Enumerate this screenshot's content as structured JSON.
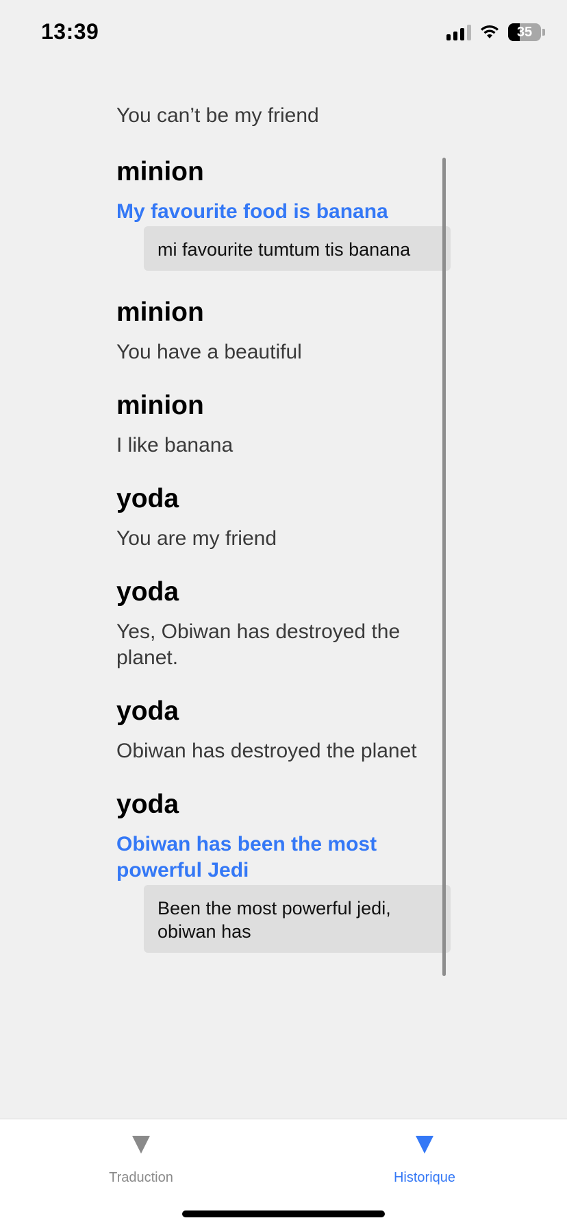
{
  "status_bar": {
    "time": "13:39",
    "battery": "35"
  },
  "history": {
    "leading_text": "You can’t be my friend",
    "entries": [
      {
        "type": "minion",
        "text": "My favourite food is banana",
        "translation": "mi favourite tumtum tis banana"
      },
      {
        "type": "minion",
        "text": "You have a beautiful"
      },
      {
        "type": "minion",
        "text": "I like banana"
      },
      {
        "type": "yoda",
        "text": "You are my friend"
      },
      {
        "type": "yoda",
        "text": "Yes, Obiwan has destroyed the planet."
      },
      {
        "type": "yoda",
        "text": "Obiwan has destroyed the planet"
      },
      {
        "type": "yoda",
        "text": "Obiwan has been the most powerful Jedi",
        "translation": "Been the most powerful jedi, obiwan has"
      }
    ]
  },
  "tab_bar": {
    "tabs": [
      {
        "label": "Traduction",
        "icon": "triangle-down-icon"
      },
      {
        "label": "Historique",
        "icon": "triangle-down-icon"
      }
    ],
    "active_tab": "Historique"
  },
  "colors": {
    "accent": "#3478f6",
    "background": "#f0f0f0",
    "translation_bg": "#dedede"
  }
}
